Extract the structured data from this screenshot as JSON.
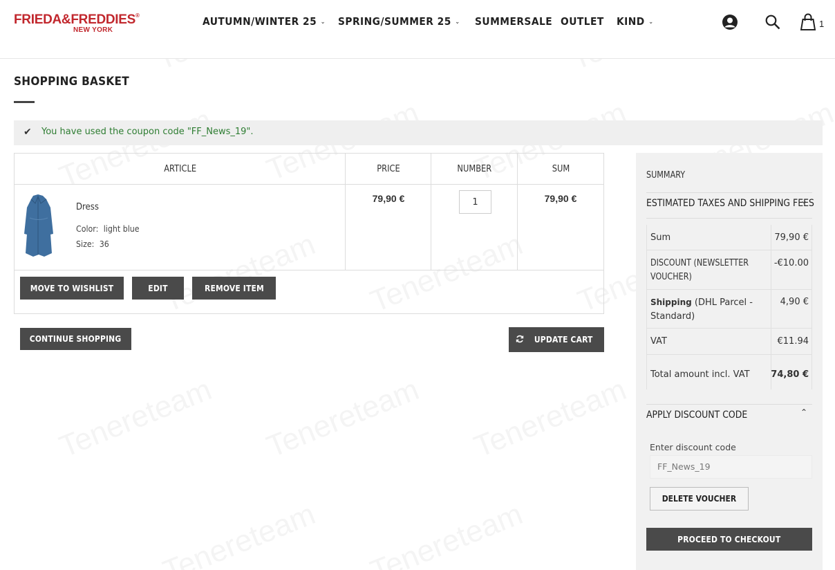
{
  "brand": {
    "name": "FRIEDA&FREDDIES",
    "reg": "®",
    "sub": "NEW YORK",
    "color": "#c1272d"
  },
  "nav": [
    {
      "label": "AUTUMN/WINTER 25",
      "dropdown": true
    },
    {
      "label": "SPRING/SUMMER 25",
      "dropdown": true
    },
    {
      "label": "SUMMERSALE",
      "dropdown": false
    },
    {
      "label": "OUTLET",
      "dropdown": false
    },
    {
      "label": "KIND",
      "dropdown": true
    }
  ],
  "header_icons": {
    "account": "user-icon",
    "search": "search-icon",
    "cart": "shopping-bag-icon",
    "cart_count": "1"
  },
  "page": {
    "title": "SHOPPING BASKET"
  },
  "message": {
    "text": "You have used the coupon code \"FF_News_19\".",
    "color": "#2e7d32"
  },
  "cart": {
    "columns": {
      "article": "ARTICLE",
      "price": "PRICE",
      "number": "NUMBER",
      "sum": "SUM"
    },
    "items": [
      {
        "name": "Dress",
        "color_label": "Color:",
        "color": "light blue",
        "size_label": "Size:",
        "size": "36",
        "price": "79,90 €",
        "qty": "1",
        "sum": "79,90 €"
      }
    ],
    "actions": {
      "wishlist": "MOVE TO WISHLIST",
      "edit": "EDIT",
      "remove": "REMOVE ITEM"
    },
    "continue": "CONTINUE SHOPPING",
    "update": "UPDATE CART"
  },
  "summary": {
    "title": "SUMMARY",
    "taxes_heading": "ESTIMATED TAXES AND SHIPPING FEES",
    "rows": {
      "sum_label": "Sum",
      "sum_value": "79,90 €",
      "discount_label": "DISCOUNT (NEWSLETTER VOUCHER)",
      "discount_value": "-€10.00",
      "shipping_label": "Shipping",
      "shipping_method": "(DHL Parcel - Standard)",
      "shipping_value": "4,90 €",
      "vat_label": "VAT",
      "vat_value": "€11.94",
      "total_label": "Total amount incl. VAT",
      "total_value": "74,80 €"
    },
    "discount_heading": "APPLY DISCOUNT CODE",
    "discount_input_label": "Enter discount code",
    "discount_input_value": "FF_News_19",
    "delete_voucher": "DELETE VOUCHER",
    "checkout": "PROCEED TO CHECKOUT"
  },
  "watermark": "Tenereteam"
}
